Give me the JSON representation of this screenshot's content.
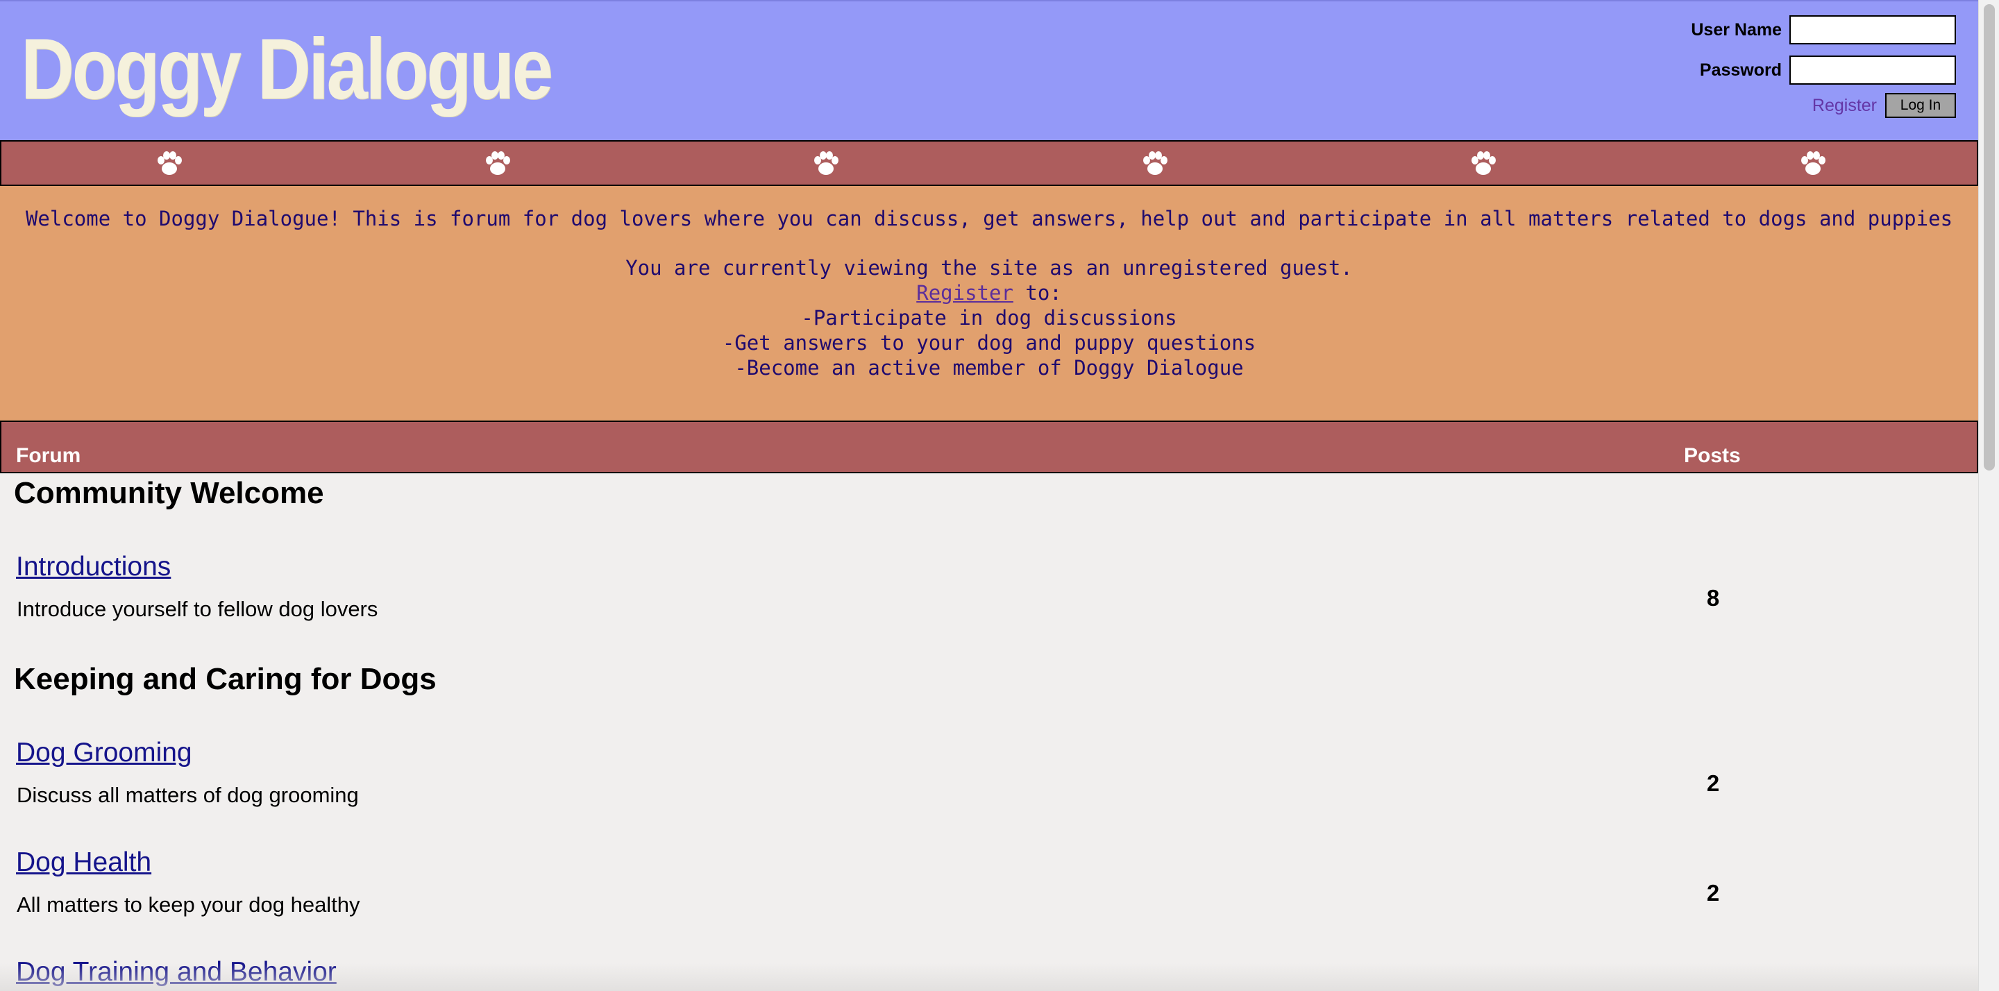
{
  "header": {
    "logo": "Doggy Dialogue",
    "username_label": "User Name",
    "password_label": "Password",
    "username_value": "",
    "password_value": "",
    "register_link": "Register",
    "login_button": "Log In"
  },
  "nav": {
    "icon": "paw-icon",
    "count": 6
  },
  "welcome": {
    "intro": "Welcome to Doggy Dialogue! This is forum for dog lovers where you can discuss, get answers, help out and participate in all matters related to dogs and puppies",
    "guest_line": "You are currently viewing the site as an unregistered guest.",
    "register_link": "Register",
    "register_suffix": " to:",
    "bullets": [
      "-Participate in dog discussions",
      "-Get answers to your dog and puppy questions",
      "-Become an active member of Doggy Dialogue"
    ]
  },
  "forum_header": {
    "forum": "Forum",
    "posts": "Posts"
  },
  "sections": [
    {
      "title": "Community Welcome",
      "forums": [
        {
          "name": "Introductions",
          "description": "Introduce yourself to fellow dog lovers",
          "posts": "8"
        }
      ]
    },
    {
      "title": "Keeping and Caring for Dogs",
      "forums": [
        {
          "name": "Dog Grooming",
          "description": "Discuss all matters of dog grooming",
          "posts": "2"
        },
        {
          "name": "Dog Health",
          "description": "All matters to keep your dog healthy",
          "posts": "2"
        },
        {
          "name": "Dog Training and Behavior",
          "description": "",
          "posts": ""
        }
      ]
    }
  ],
  "colors": {
    "header_bg": "#9499f8",
    "logo": "#f5f1dc",
    "nav_bg": "#ad5d5d",
    "welcome_bg": "#e1a06e",
    "welcome_text": "#1f0a6e",
    "link": "#15148b",
    "page_bg": "#f1efee"
  }
}
